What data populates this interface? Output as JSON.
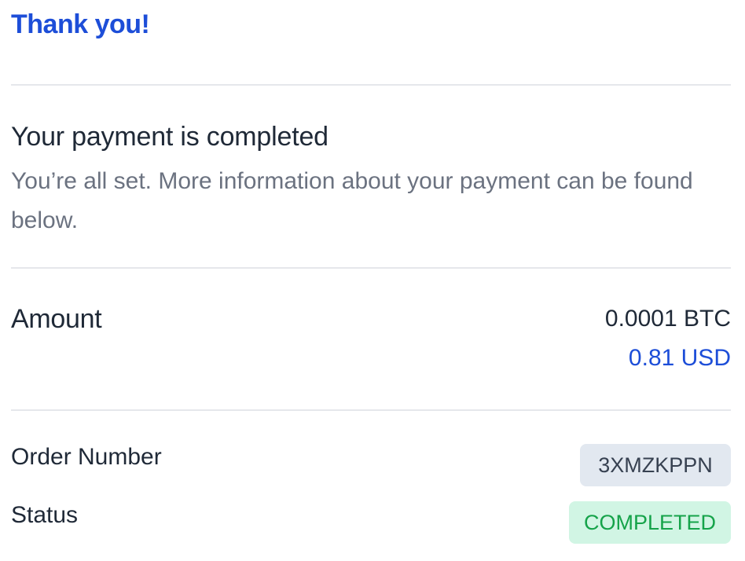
{
  "header": {
    "title": "Thank you!"
  },
  "message": {
    "heading": "Your payment is completed",
    "description": "You’re all set. More information about your payment can be found below."
  },
  "amount": {
    "label": "Amount",
    "crypto": "0.0001 BTC",
    "fiat": "0.81 USD"
  },
  "details": {
    "order_number_label": "Order Number",
    "order_number_value": "3XMZKPPN",
    "status_label": "Status",
    "status_value": "COMPLETED"
  },
  "colors": {
    "accent": "#1d4ed8",
    "text": "#1f2937",
    "muted": "#6b7280",
    "divider": "#e5e7eb",
    "order_badge_bg": "#e2e8f0",
    "status_badge_bg": "#d1f5e4",
    "status_badge_text": "#15a34a"
  }
}
